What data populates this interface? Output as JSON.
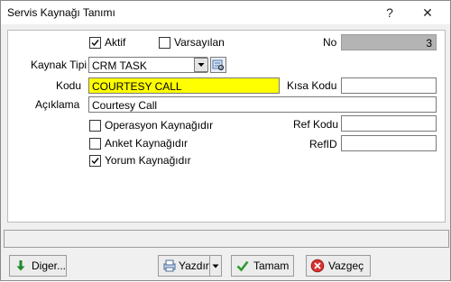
{
  "window": {
    "title": "Servis Kaynağı Tanımı",
    "help_label": "?",
    "close_label": "✕"
  },
  "form": {
    "aktif": {
      "label": "Aktif",
      "checked": true
    },
    "varsayilan": {
      "label": "Varsayılan",
      "checked": false
    },
    "no": {
      "label": "No",
      "value": "3"
    },
    "kaynak_tipi": {
      "label": "Kaynak Tipi",
      "value": "CRM TASK"
    },
    "kodu": {
      "label": "Kodu",
      "value": "COURTESY CALL"
    },
    "kisa_kodu": {
      "label": "Kısa Kodu",
      "value": ""
    },
    "aciklama": {
      "label": "Açıklama",
      "value": "Courtesy Call"
    },
    "operasyon": {
      "label": "Operasyon Kaynağıdır",
      "checked": false
    },
    "anket": {
      "label": "Anket Kaynağıdır",
      "checked": false
    },
    "yorum": {
      "label": "Yorum Kaynağıdır",
      "checked": true
    },
    "ref_kodu": {
      "label": "Ref Kodu",
      "value": ""
    },
    "ref_id": {
      "label": "RefID",
      "value": ""
    }
  },
  "buttons": {
    "diger": "Diger...",
    "yazdir": "Yazdır",
    "tamam": "Tamam",
    "vazgec": "Vazgeç"
  },
  "colors": {
    "highlight_field": "#ffff00",
    "readonly_field": "#b4b4b4"
  },
  "icons": [
    "question-icon",
    "close-icon",
    "dropdown-arrow-icon",
    "lookup-icon",
    "download-arrow-icon",
    "print-icon",
    "checkmark-icon",
    "cancel-icon"
  ]
}
